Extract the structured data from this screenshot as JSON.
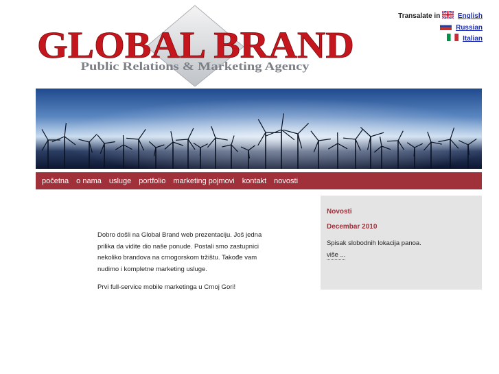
{
  "logo": {
    "title": "GLOBAL BRAND",
    "subtitle": "Public Relations & Marketing Agency"
  },
  "language": {
    "label": "Transalate in",
    "options": [
      {
        "name": "English",
        "icon": "uk-flag-icon"
      },
      {
        "name": "Russian",
        "icon": "russia-flag-icon"
      },
      {
        "name": "Italian",
        "icon": "italy-flag-icon"
      }
    ]
  },
  "nav": {
    "items": [
      "početna",
      "o nama",
      "usluge",
      "portfolio",
      "marketing pojmovi",
      "kontakt",
      "novosti"
    ]
  },
  "content": {
    "paragraph1": "Dobro došli na Global Brand web prezentaciju. Još jedna prilika da vidite dio naše ponude. Postali smo zastupnici nekoliko brandova na crnogorskom tržištu. Takođe vam nudimo i kompletne marketing usluge.",
    "paragraph2": "Prvi full-service mobile marketinga u Crnoj Gori!"
  },
  "sidebar": {
    "title": "Novosti",
    "date": "Decembar 2010",
    "text": "Spisak slobodnih lokacija panoa.",
    "more": "više ..."
  },
  "colors": {
    "brand_red": "#a0313a",
    "link_blue": "#1f2fb0",
    "sidebar_bg": "#e4e4e4"
  }
}
